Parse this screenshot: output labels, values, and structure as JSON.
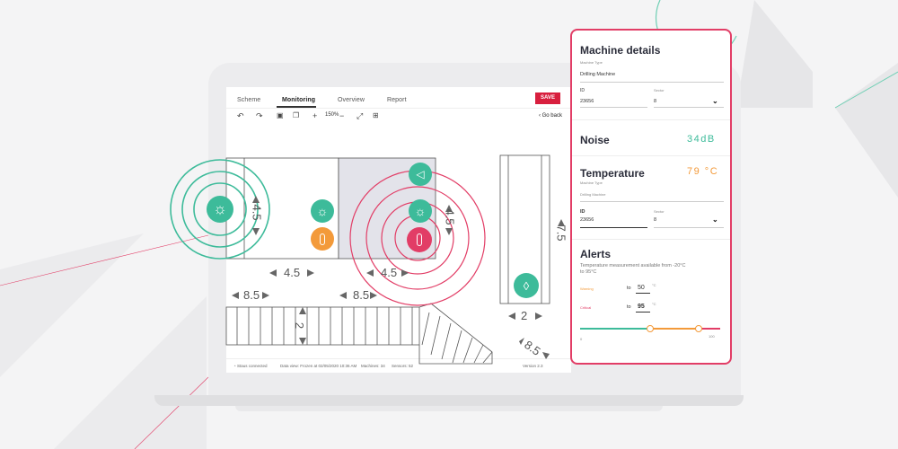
{
  "app": {
    "tabs": [
      {
        "label": "Scheme"
      },
      {
        "label": "Monitoring"
      },
      {
        "label": "Overview"
      },
      {
        "label": "Report"
      }
    ],
    "save_label": "SAVE",
    "go_back_label": "Go back",
    "zoom_label": "150%"
  },
  "status_bar": {
    "connection": "Staus connected",
    "data_view": "Data view: Frozen at 02/05/2020 10:36 AM",
    "machines": "Machines: 34",
    "sensors": "Sensors: 52",
    "version": "Version 2.3"
  },
  "canvas": {
    "dimensions": [
      "4.5",
      "4.5",
      "4.5",
      "4.5",
      "8.5",
      "8.5",
      "2",
      "2",
      "8.5",
      "7.5"
    ]
  },
  "details_panel": {
    "machine_details": {
      "title": "Machine details",
      "type_caption": "Machine Type",
      "type_value": "Drilling Machine",
      "id_label": "ID",
      "id_value": "23656",
      "sector_label": "Sector",
      "sector_value": "8"
    },
    "noise": {
      "title": "Noise",
      "value": "34dB",
      "color": "#3dbb9a"
    },
    "temperature": {
      "title": "Temperature",
      "value": "79 °C",
      "color": "#f39a3a",
      "type_caption": "Machine Type",
      "type_value": "Drilling Machine",
      "id_label": "ID",
      "id_value": "23656",
      "sector_label": "Sector",
      "sector_value": "8"
    },
    "alerts": {
      "title": "Alerts",
      "description": "Temperature measurement available from -20°C to 95°C",
      "warning_label": "Warning",
      "warning_to": "to",
      "warning_value": "50",
      "warning_unit": "°C",
      "critical_label": "Critical",
      "critical_to": "to",
      "critical_value": "95",
      "critical_unit": "°C",
      "slider_min": "0",
      "slider_max": "100",
      "colors": {
        "ok": "#3dbb9a",
        "warning": "#f39a3a",
        "critical": "#e23d66"
      }
    }
  },
  "colors": {
    "accent_green": "#3dbb9a",
    "accent_orange": "#f39a3a",
    "accent_red": "#e23d66",
    "save_red": "#d81f3e"
  }
}
